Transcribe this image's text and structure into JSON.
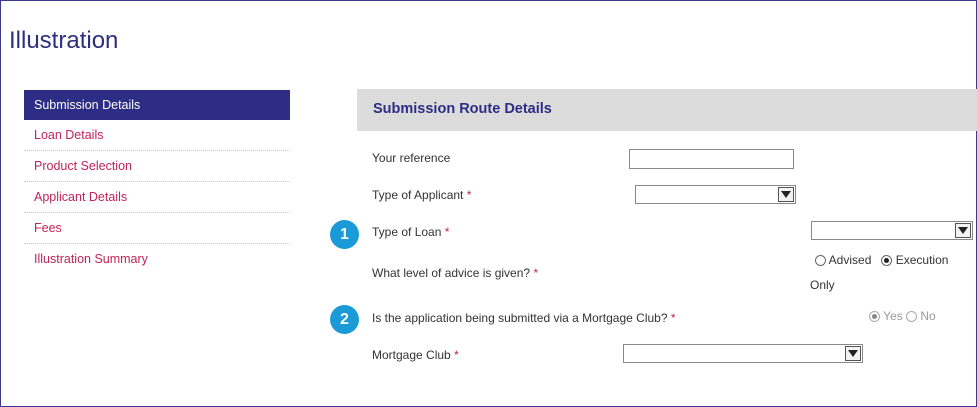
{
  "page": {
    "title": "Illustration"
  },
  "sidebar": {
    "items": [
      {
        "label": "Submission Details"
      },
      {
        "label": "Loan Details"
      },
      {
        "label": "Product Selection"
      },
      {
        "label": "Applicant Details"
      },
      {
        "label": "Fees"
      },
      {
        "label": "Illustration Summary"
      }
    ],
    "active_index": 0
  },
  "section": {
    "title": "Submission Route Details"
  },
  "form": {
    "your_reference": {
      "label": "Your reference",
      "value": ""
    },
    "type_of_applicant": {
      "label": "Type of Applicant",
      "required_mark": "*",
      "selected": ""
    },
    "type_of_loan": {
      "label": "Type of Loan",
      "required_mark": "*",
      "selected": ""
    },
    "advice_level": {
      "label": "What level of advice is given?",
      "required_mark": "*",
      "options": [
        "Advised",
        "Execution",
        "Only"
      ],
      "selected": "Execution Only"
    },
    "mortgage_club_submission": {
      "label": "Is the application being submitted via a Mortgage Club?",
      "required_mark": "*",
      "options": [
        "Yes",
        "No"
      ],
      "selected": "Yes"
    },
    "mortgage_club": {
      "label": "Mortgage Club",
      "required_mark": "*",
      "selected": ""
    }
  },
  "callouts": [
    "1",
    "2"
  ],
  "colors": {
    "accent": "#2d2d86",
    "link": "#c0245a",
    "badge": "#1a9ad6",
    "header_bg": "#dcdcdc"
  }
}
